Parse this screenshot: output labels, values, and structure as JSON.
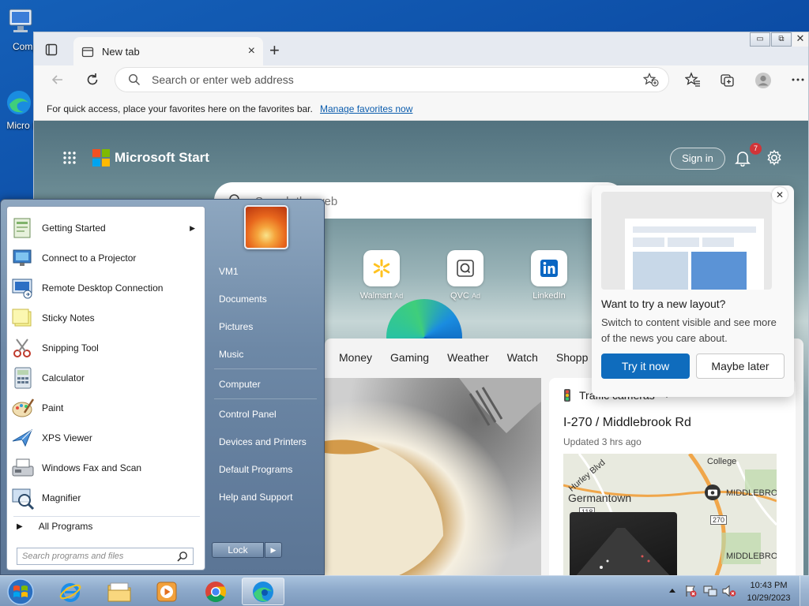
{
  "desktop": {
    "icons": [
      {
        "label": "Comp",
        "icon": "computer-icon"
      },
      {
        "label": "Micro Ed",
        "icon": "edge-shortcut-icon"
      }
    ]
  },
  "browser": {
    "tab": {
      "title": "New tab",
      "close": "×"
    },
    "new_tab": "+",
    "window_controls": {
      "minimize": "▭",
      "maximize": "⧉",
      "close": "✕"
    },
    "address_placeholder": "Search or enter web address",
    "favorites_bar": {
      "text": "For quick access, place your favorites here on the favorites bar.",
      "link": "Manage favorites now"
    },
    "accent": "#0f6cbd"
  },
  "page": {
    "brand": "Microsoft Start",
    "signin": "Sign in",
    "notification_count": "7",
    "search_placeholder": "Search the web",
    "quick_links": [
      {
        "label": "Walmart",
        "ad": "Ad"
      },
      {
        "label": "QVC",
        "ad": "Ad"
      },
      {
        "label": "LinkedIn",
        "ad": ""
      }
    ],
    "categories": [
      "Money",
      "Gaming",
      "Weather",
      "Watch",
      "Shopp"
    ],
    "traffic": {
      "header": "Traffic cameras",
      "more": "···",
      "title": "I-270 / Middlebrook Rd",
      "updated": "Updated 3 hrs ago",
      "map_labels": {
        "college": "College",
        "hurley": "Hurley Blvd",
        "germantown": "Germantown",
        "middlebrook1": "MIDDLEBRO",
        "middlebrook2": "MIDDLEBRO",
        "route": "270",
        "route2": "118"
      }
    },
    "popup": {
      "close": "✕",
      "title": "Want to try a new layout?",
      "body": "Switch to content visible and see more of the news you care about.",
      "try_label": "Try it now",
      "later_label": "Maybe later"
    }
  },
  "start_menu": {
    "programs": [
      {
        "label": "Getting Started",
        "icon": "getting-started-icon",
        "has_submenu": true
      },
      {
        "label": "Connect to a Projector",
        "icon": "projector-icon"
      },
      {
        "label": "Remote Desktop Connection",
        "icon": "remote-desktop-icon"
      },
      {
        "label": "Sticky Notes",
        "icon": "sticky-notes-icon"
      },
      {
        "label": "Snipping Tool",
        "icon": "snipping-tool-icon"
      },
      {
        "label": "Calculator",
        "icon": "calculator-icon"
      },
      {
        "label": "Paint",
        "icon": "paint-icon"
      },
      {
        "label": "XPS Viewer",
        "icon": "xps-viewer-icon"
      },
      {
        "label": "Windows Fax and Scan",
        "icon": "fax-scan-icon"
      },
      {
        "label": "Magnifier",
        "icon": "magnifier-icon"
      }
    ],
    "all_programs": "All Programs",
    "search_placeholder": "Search programs and files",
    "user": "VM1",
    "right_items": [
      "Documents",
      "Pictures",
      "Music",
      "Computer",
      "Control Panel",
      "Devices and Printers",
      "Default Programs",
      "Help and Support"
    ],
    "lock": "Lock"
  },
  "taskbar": {
    "apps": [
      "internet-explorer-icon",
      "file-explorer-icon",
      "media-player-icon",
      "chrome-icon",
      "edge-icon"
    ],
    "time": "10:43 PM",
    "date": "10/29/2023"
  }
}
